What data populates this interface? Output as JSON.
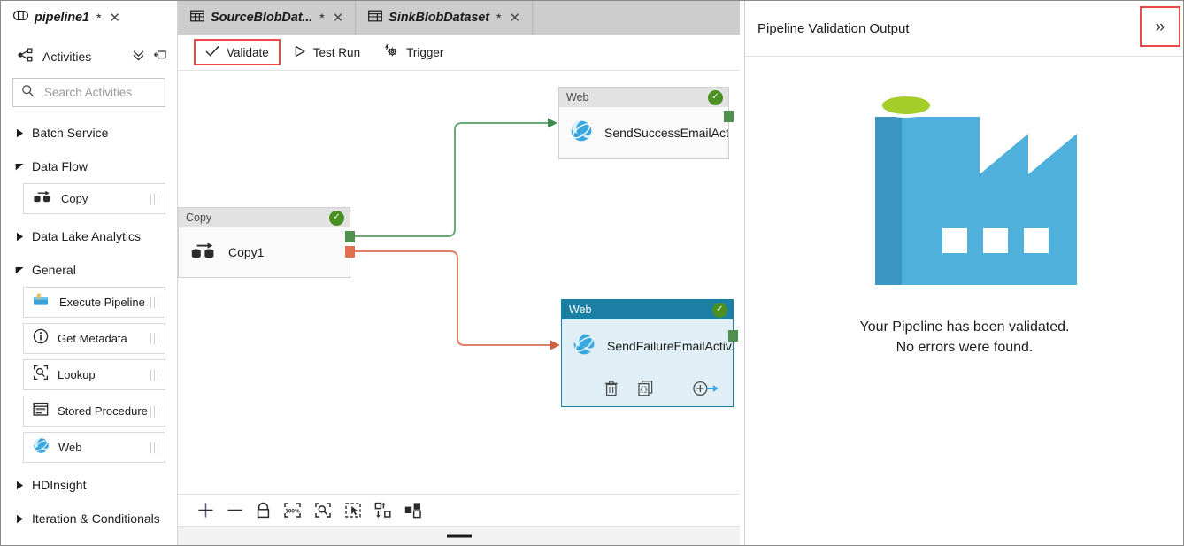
{
  "tabs": [
    {
      "name": "pipeline1",
      "dirty": "*",
      "icon": "pipeline-icon",
      "active": true
    },
    {
      "name": "SourceBlobDat...",
      "dirty": "*",
      "icon": "dataset-table-icon",
      "active": false
    },
    {
      "name": "SinkBlobDataset",
      "dirty": "*",
      "icon": "dataset-table-icon",
      "active": false
    }
  ],
  "sidebar": {
    "header_label": "Activities",
    "collapse_all_icon": "chevron-double-down-icon",
    "pin_icon": "pin-icon",
    "activities_icon": "share-nodes-icon",
    "search": {
      "placeholder": "Search Activities",
      "value": "",
      "icon": "search-icon"
    },
    "categories": [
      {
        "label": "Batch Service",
        "expanded": false,
        "items": []
      },
      {
        "label": "Data Flow",
        "expanded": true,
        "items": [
          {
            "label": "Copy",
            "icon": "copy-activity-icon"
          }
        ]
      },
      {
        "label": "Data Lake Analytics",
        "expanded": false,
        "items": []
      },
      {
        "label": "General",
        "expanded": true,
        "items": [
          {
            "label": "Execute Pipeline",
            "icon": "execute-pipeline-icon"
          },
          {
            "label": "Get Metadata",
            "icon": "info-circle-icon"
          },
          {
            "label": "Lookup",
            "icon": "lookup-magnifier-icon"
          },
          {
            "label": "Stored Procedure",
            "icon": "stored-procedure-icon"
          },
          {
            "label": "Web",
            "icon": "web-globe-icon"
          }
        ]
      },
      {
        "label": "HDInsight",
        "expanded": false,
        "items": []
      },
      {
        "label": "Iteration & Conditionals",
        "expanded": false,
        "items": []
      }
    ]
  },
  "command_bar": {
    "validate_label": "Validate",
    "validate_icon": "checkmark-icon",
    "validate_highlighted": true,
    "test_run_label": "Test Run",
    "test_run_icon": "play-triangle-icon",
    "trigger_label": "Trigger",
    "trigger_icon": "gear-lightning-icon"
  },
  "canvas": {
    "nodes": [
      {
        "id": "copy",
        "type_label": "Copy",
        "name": "Copy1",
        "icon": "copy-activity-icon",
        "status": "valid",
        "status_icon": "green-check-icon",
        "selected": false
      },
      {
        "id": "success",
        "type_label": "Web",
        "name": "SendSuccessEmailActi..",
        "icon": "web-globe-icon",
        "status": "valid",
        "status_icon": "green-check-icon",
        "selected": false
      },
      {
        "id": "failure",
        "type_label": "Web",
        "name": "SendFailureEmailActiv..",
        "icon": "web-globe-icon",
        "status": "valid",
        "status_icon": "green-check-icon",
        "selected": true,
        "actions": [
          {
            "name": "delete",
            "icon": "trash-icon"
          },
          {
            "name": "view-code",
            "icon": "code-braces-icon"
          },
          {
            "name": "add-output",
            "icon": "add-arrow-icon"
          }
        ]
      }
    ],
    "edges": [
      {
        "from": "copy",
        "to": "success",
        "kind": "success",
        "color": "#6aab79"
      },
      {
        "from": "copy",
        "to": "failure",
        "kind": "failure",
        "color": "#e0816a"
      }
    ],
    "toolbar": [
      {
        "name": "zoom-in",
        "icon": "plus-icon",
        "label": "+"
      },
      {
        "name": "zoom-out",
        "icon": "minus-icon",
        "label": "-"
      },
      {
        "name": "lock-canvas",
        "icon": "lock-icon"
      },
      {
        "name": "zoom-100",
        "icon": "zoom-100-percent-icon",
        "label": "100%"
      },
      {
        "name": "zoom-to-fit",
        "icon": "zoom-fit-icon"
      },
      {
        "name": "select-mode",
        "icon": "cursor-select-icon"
      },
      {
        "name": "auto-align",
        "icon": "auto-align-icon"
      },
      {
        "name": "layout-nodes",
        "icon": "node-layout-icon"
      }
    ]
  },
  "right_panel": {
    "title": "Pipeline Validation Output",
    "collapse_icon": "chevron-double-right-icon",
    "collapse_highlighted": true,
    "illustration": "factory-icon",
    "message_line1": "Your Pipeline has been validated.",
    "message_line2": "No errors were found."
  },
  "colors": {
    "tab_bar_bg": "#cdcdcd",
    "selected_node_header": "#1b7ea3",
    "selected_node_body": "#e0eff5",
    "success_edge": "#6aab79",
    "failure_edge": "#e0816a",
    "highlight_box": "#e8494a",
    "status_check": "#4a8f22",
    "factory_blue": "#4fb0dc",
    "factory_dark_blue": "#3b96c4",
    "factory_green": "#a5cd29"
  }
}
